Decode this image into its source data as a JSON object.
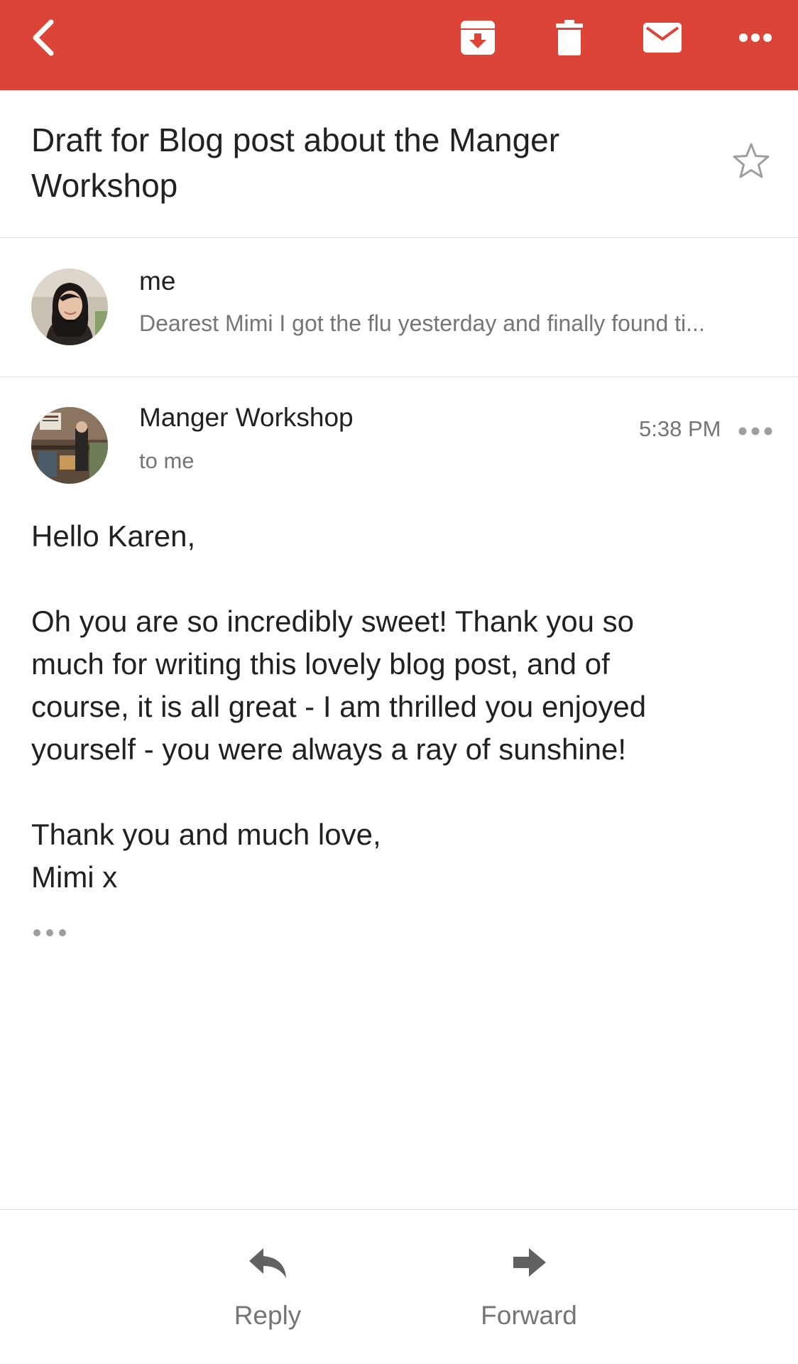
{
  "toolbar": {
    "back_icon": "chevron-left-icon",
    "archive_icon": "archive-icon",
    "delete_icon": "trash-icon",
    "mark_unread_icon": "envelope-icon",
    "more_icon": "more-horizontal-icon",
    "color": "#db4437"
  },
  "subject": "Draft for Blog post about the Manger Workshop",
  "star_icon": "star-outline-icon",
  "collapsed_message": {
    "sender": "me",
    "snippet": "Dearest Mimi I got the flu yesterday and finally found ti..."
  },
  "message": {
    "sender": "Manger Workshop",
    "recipient": "to me",
    "time": "5:38 PM",
    "greeting": "Hello Karen,",
    "paragraph1_line1": "Oh you are so incredibly sweet! Thank you so",
    "paragraph1_line2": "much for writing this lovely blog post, and of",
    "paragraph1_line3": "course, it is all great - I am thrilled you enjoyed",
    "paragraph1_line4": "yourself - you were always a ray of sunshine!",
    "closing": "Thank you and much love,",
    "signature": "Mimi x"
  },
  "actions": {
    "reply_label": "Reply",
    "forward_label": "Forward"
  }
}
